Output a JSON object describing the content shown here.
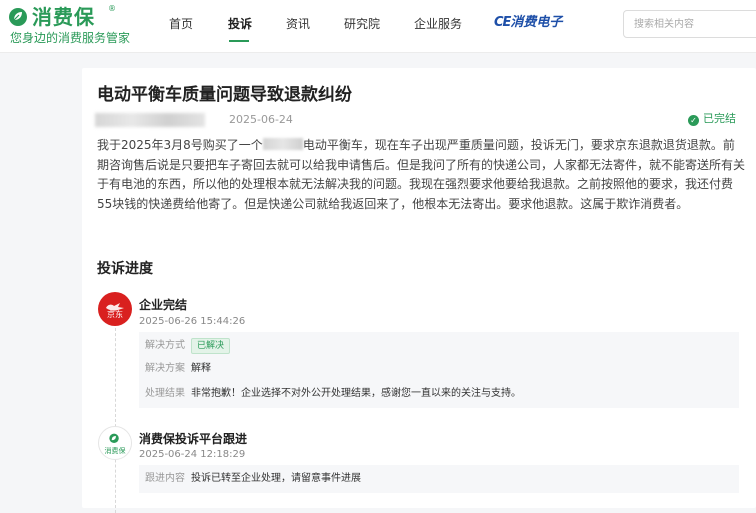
{
  "brand": {
    "name": "消费保",
    "reg": "®",
    "slogan": "您身边的消费服务管家"
  },
  "nav": {
    "items": [
      {
        "label": "首页"
      },
      {
        "label": "投诉"
      },
      {
        "label": "资讯"
      },
      {
        "label": "研究院"
      },
      {
        "label": "企业服务"
      }
    ],
    "partner": {
      "prefix": "CE",
      "label": "消费电子"
    },
    "search_placeholder": "搜索相关内容"
  },
  "complaint": {
    "title": "电动平衡车质量问题导致退款纠纷",
    "date": "2025-06-24",
    "status": "已完结",
    "content_part1": "我于2025年3月8号购买了一个",
    "content_part2": "电动平衡车，现在车子出现严重质量问题，投诉无门，要求京东退款退货退款。前期咨询售后说是只要把车子寄回去就可以给我申请售后。但是我问了所有的快递公司，人家都无法寄件，就不能寄送所有关于有电池的东西，所以他的处理根本就无法解决我的问题。我现在强烈要求他要给我退款。之前按照他的要求，我还付费55块钱的快递费给他寄了。但是快递公司就给我返回来了，他根本无法寄出。要求他退款。这属于欺诈消费者。"
  },
  "progress": {
    "title": "投诉进度",
    "entries": [
      {
        "avatar_text": "京东",
        "name": "企业完结",
        "time": "2025-06-26 15:44:26",
        "rows": [
          {
            "key": "解决方式",
            "value": "已解决"
          },
          {
            "key": "解决方案",
            "value": "解释"
          },
          {
            "key": "处理结果",
            "value": "非常抱歉！企业选择不对外公开处理结果，感谢您一直以来的关注与支持。"
          }
        ]
      },
      {
        "avatar_text": "消费保",
        "name": "消费保投诉平台跟进",
        "time": "2025-06-24 12:18:29",
        "rows": [
          {
            "key": "跟进内容",
            "value": "投诉已转至企业处理，请留意事件进展"
          }
        ]
      }
    ]
  },
  "colors": {
    "brand_green": "#2a9a58",
    "jd_red": "#d9201f",
    "ce_blue": "#1e4fa8"
  }
}
